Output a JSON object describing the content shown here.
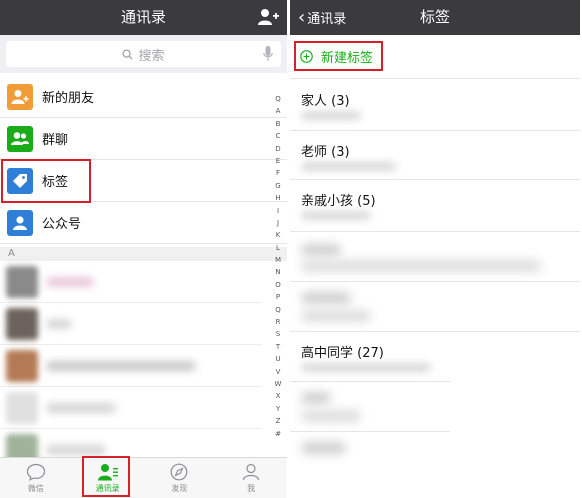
{
  "left": {
    "title": "通讯录",
    "search_placeholder": "搜索",
    "menu": [
      {
        "label": "新的朋友",
        "icon": "new-friend-icon",
        "color": "#f29c38"
      },
      {
        "label": "群聊",
        "icon": "group-chat-icon",
        "color": "#1aad19"
      },
      {
        "label": "标签",
        "icon": "tag-icon",
        "color": "#2f7ed8"
      },
      {
        "label": "公众号",
        "icon": "official-account-icon",
        "color": "#2f7ed8"
      }
    ],
    "section_header": "A",
    "index_letters": [
      "Q",
      "A",
      "B",
      "C",
      "D",
      "E",
      "F",
      "G",
      "H",
      "I",
      "J",
      "K",
      "L",
      "M",
      "N",
      "O",
      "P",
      "Q",
      "R",
      "S",
      "T",
      "U",
      "V",
      "W",
      "X",
      "Y",
      "Z",
      "#"
    ],
    "tabs": [
      {
        "label": "微信",
        "icon": "chat-bubble-icon"
      },
      {
        "label": "通讯录",
        "icon": "contacts-icon"
      },
      {
        "label": "发现",
        "icon": "compass-icon"
      },
      {
        "label": "我",
        "icon": "person-icon"
      }
    ]
  },
  "right": {
    "back_label": "通讯录",
    "title": "标签",
    "new_tag_label": "新建标签",
    "tags": [
      {
        "name": "家人 (3)"
      },
      {
        "name": "老师 (3)"
      },
      {
        "name": "亲戚小孩 (5)"
      },
      {
        "name": "高中同学 (27)"
      }
    ]
  },
  "colors": {
    "nav_bg": "#3a3a3f",
    "accent_green": "#1aad19",
    "highlight_red": "#d6202a"
  }
}
